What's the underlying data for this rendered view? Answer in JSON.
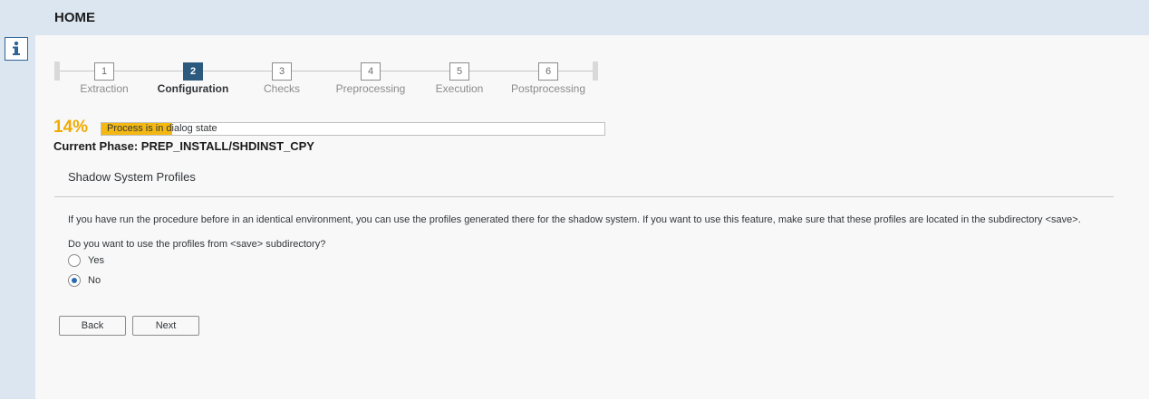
{
  "header": {
    "title": "HOME"
  },
  "sidebar": {
    "info_icon": "info-icon"
  },
  "stepper": {
    "steps": [
      {
        "number": "1",
        "label": "Extraction",
        "active": false
      },
      {
        "number": "2",
        "label": "Configuration",
        "active": true
      },
      {
        "number": "3",
        "label": "Checks",
        "active": false
      },
      {
        "number": "4",
        "label": "Preprocessing",
        "active": false
      },
      {
        "number": "5",
        "label": "Execution",
        "active": false
      },
      {
        "number": "6",
        "label": "Postprocessing",
        "active": false
      }
    ]
  },
  "progress": {
    "percent_text": "14%",
    "fraction": 0.14,
    "status_text": "Process is in dialog state",
    "current_phase": "Current Phase: PREP_INSTALL/SHDINST_CPY"
  },
  "section": {
    "title": "Shadow System Profiles",
    "description": "If you have run the procedure before in an identical environment, you can use the profiles generated there for the shadow system. If you want to use this feature, make sure that these profiles are located in the subdirectory <save>.",
    "question": "Do you want to use the profiles from <save> subdirectory?",
    "options": [
      {
        "label": "Yes",
        "selected": false
      },
      {
        "label": "No",
        "selected": true
      }
    ]
  },
  "buttons": {
    "back": "Back",
    "next": "Next"
  },
  "colors": {
    "accent": "#2c5a7f",
    "progress_fill": "#f3b812",
    "percent": "#f0ab00",
    "radio_selected": "#2b6cb0"
  }
}
